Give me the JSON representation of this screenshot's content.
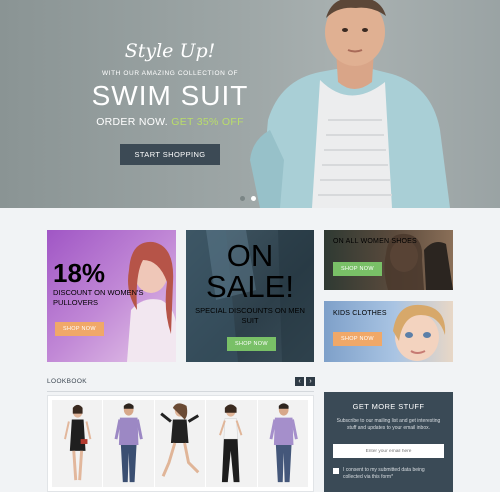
{
  "hero": {
    "script_title": "Style Up!",
    "subtitle": "WITH OUR AMAZING COLLECTION OF",
    "title": "SWIM SUIT",
    "order_prefix": "ORDER NOW.",
    "order_highlight": "GET 35% OFF",
    "button_label": "START SHOPPING",
    "slide_count": 2,
    "active_slide": 2
  },
  "promos": {
    "percent": {
      "value": "18%",
      "text": "DISCOUNT ON WOMEN'S PULLOVERS",
      "button": "SHOP NOW"
    },
    "sale": {
      "line1": "ON",
      "line2": "SALE!",
      "text": "SPECIAL DISCOUNTS ON MEN SUIT",
      "button": "SHOP NOW"
    },
    "women": {
      "text": "ON ALL WOMEN SHOES",
      "button": "SHOP NOW"
    },
    "kids": {
      "text": "KIDS CLOTHES",
      "button": "SHOP NOW"
    }
  },
  "lookbook": {
    "title": "LOOKBOOK",
    "prev_icon": "chevron-left-icon",
    "next_icon": "chevron-right-icon",
    "prev_glyph": "‹",
    "next_glyph": "›",
    "items": [
      "model-woman-black-dress",
      "model-man-purple-shirt",
      "model-woman-jumping",
      "model-woman-black-pants",
      "model-man-purple-shirt-2"
    ]
  },
  "newsletter": {
    "title": "GET MORE STUFF",
    "description": "Subscribe to our mailing list and get interesting stuff and updates to your email inbox.",
    "email_placeholder": "Enter your email here",
    "consent_text": "I consent to my submitted data being collected via this form*"
  },
  "colors": {
    "hero_button": "#3c4a55",
    "highlight_green": "#b9dd6a",
    "shop_orange": "#f0a868",
    "shop_green": "#79c067",
    "newsletter_bg": "#3a4a56"
  }
}
